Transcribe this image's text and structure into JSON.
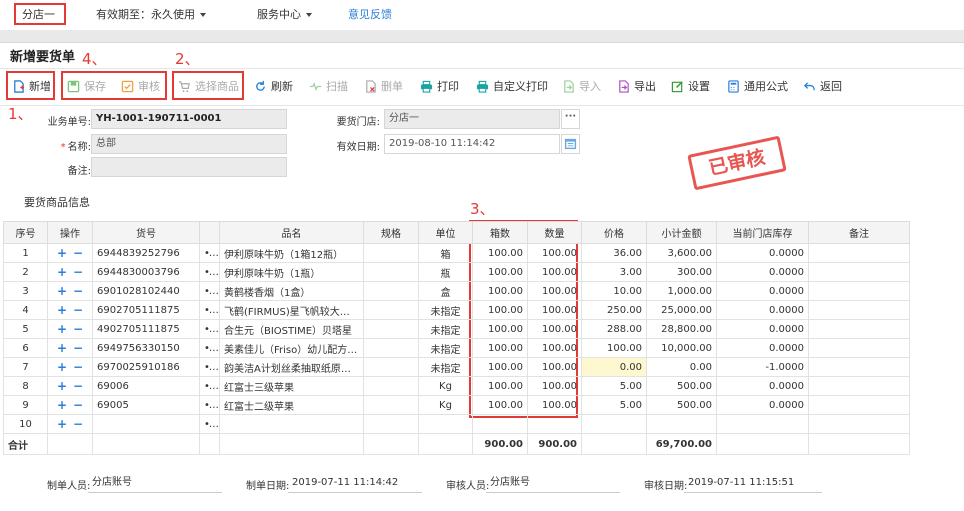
{
  "topbar": {
    "store": "分店一",
    "validity": "有效期至：永久使用",
    "service": "服务中心",
    "feedback": "意见反馈"
  },
  "page_title": "新增要货单",
  "toolbar": {
    "new": "新增",
    "save": "保存",
    "audit": "审核",
    "select_goods": "选择商品",
    "refresh": "刷新",
    "scan": "扫描",
    "delete_row": "删单",
    "print": "打印",
    "custom_print": "自定义打印",
    "import": "导入",
    "export": "导出",
    "settings": "设置",
    "formula": "通用公式",
    "back": "返回"
  },
  "annotations": {
    "a1": "1、",
    "a2": "2、",
    "a3": "3、",
    "a4": "4、"
  },
  "form": {
    "order_no_label": "业务单号:",
    "order_no": "YH-1001-190711-0001",
    "name_label": "名称:",
    "name": "总部",
    "remark_label": "备注:",
    "store_label": "要货门店:",
    "store": "分店一",
    "date_label": "有效日期:",
    "date": "2019-08-10 11:14:42"
  },
  "stamp": "已审核",
  "section_title": "要货商品信息",
  "grid": {
    "headers": [
      "序号",
      "操作",
      "货号",
      "",
      "品名",
      "规格",
      "单位",
      "箱数",
      "数量",
      "价格",
      "小计金额",
      "当前门店库存",
      "备注"
    ],
    "rows": [
      {
        "no": "1",
        "code": "6944839252796",
        "name": "伊利原味牛奶（1箱12瓶）",
        "unit": "箱",
        "boxes": "100.00",
        "qty": "100.00",
        "price": "36.00",
        "subtotal": "3,600.00",
        "stock": "0.0000"
      },
      {
        "no": "2",
        "code": "6944830003796",
        "name": "伊利原味牛奶（1瓶）",
        "unit": "瓶",
        "boxes": "100.00",
        "qty": "100.00",
        "price": "3.00",
        "subtotal": "300.00",
        "stock": "0.0000"
      },
      {
        "no": "3",
        "code": "6901028102440",
        "name": "黄鹤楼香烟（1盒）",
        "unit": "盒",
        "boxes": "100.00",
        "qty": "100.00",
        "price": "10.00",
        "subtotal": "1,000.00",
        "stock": "0.0000"
      },
      {
        "no": "4",
        "code": "6902705111875",
        "name": "飞鹤(FIRMUS)星飞帆较大婴儿...",
        "unit": "未指定",
        "boxes": "100.00",
        "qty": "100.00",
        "price": "250.00",
        "subtotal": "25,000.00",
        "stock": "0.0000"
      },
      {
        "no": "5",
        "code": "4902705111875",
        "name": "合生元（BIOSTIME）贝塔星",
        "unit": "未指定",
        "boxes": "100.00",
        "qty": "100.00",
        "price": "288.00",
        "subtotal": "28,800.00",
        "stock": "0.0000"
      },
      {
        "no": "6",
        "code": "6949756330150",
        "name": "美素佳儿（Friso）幼儿配方奶...",
        "unit": "未指定",
        "boxes": "100.00",
        "qty": "100.00",
        "price": "100.00",
        "subtotal": "10,000.00",
        "stock": "0.0000"
      },
      {
        "no": "7",
        "code": "6970025910186",
        "name": "韵美洁A计划丝柔抽取纸原生...",
        "unit": "未指定",
        "boxes": "100.00",
        "qty": "100.00",
        "price": "0.00",
        "subtotal": "0.00",
        "stock": "-1.0000"
      },
      {
        "no": "8",
        "code": "69006",
        "name": "红富士三级苹果",
        "unit": "Kg",
        "boxes": "100.00",
        "qty": "100.00",
        "price": "5.00",
        "subtotal": "500.00",
        "stock": "0.0000"
      },
      {
        "no": "9",
        "code": "69005",
        "name": "红富士二级苹果",
        "unit": "Kg",
        "boxes": "100.00",
        "qty": "100.00",
        "price": "5.00",
        "subtotal": "500.00",
        "stock": "0.0000"
      },
      {
        "no": "10",
        "code": "",
        "name": "",
        "unit": "",
        "boxes": "",
        "qty": "",
        "price": "",
        "subtotal": "",
        "stock": ""
      }
    ],
    "total": {
      "label": "合计",
      "boxes": "900.00",
      "qty": "900.00",
      "subtotal": "69,700.00"
    }
  },
  "footer": {
    "maker_label": "制单人员:",
    "maker": "分店账号",
    "make_date_label": "制单日期:",
    "make_date": "2019-07-11 11:14:42",
    "auditor_label": "审核人员:",
    "auditor": "分店账号",
    "audit_date_label": "审核日期:",
    "audit_date": "2019-07-11 11:15:51"
  },
  "colors": {
    "accent_red": "#e53935",
    "link_blue": "#2b7ed8",
    "highlight_yellow": "#fdf8cf"
  }
}
